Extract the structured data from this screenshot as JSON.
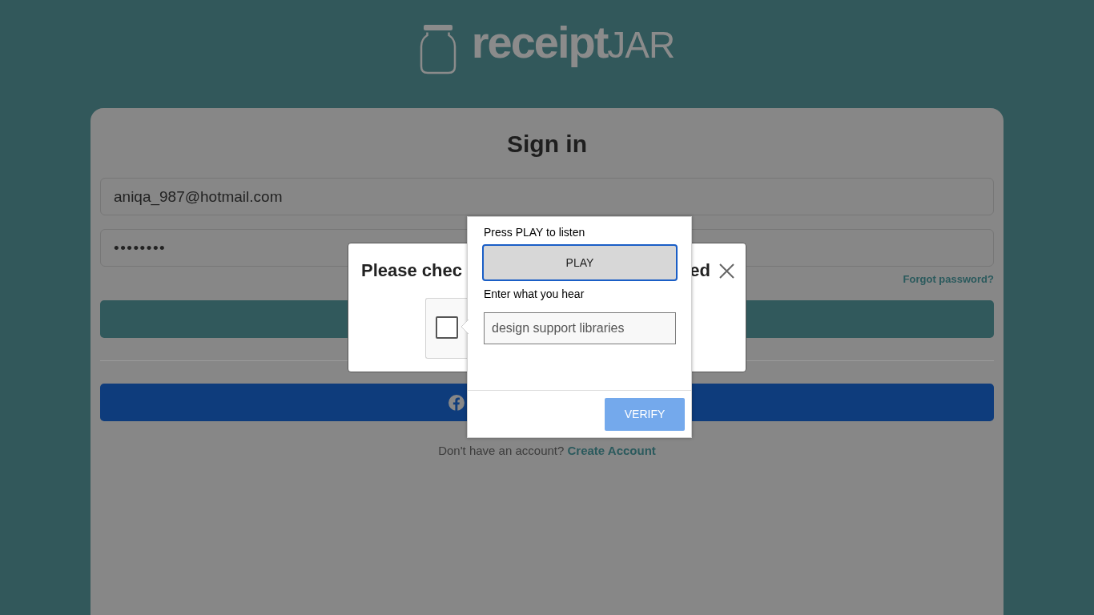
{
  "logo": {
    "text": "**receipt**JAR"
  },
  "sign_in": {
    "title": "Sign in",
    "email_field": {
      "value": "aniqa_987@hotmail.com"
    },
    "password_field": {
      "value": "••••••••"
    },
    "forgot_password_link": "Forgot password?",
    "signup_prompt": {
      "text": "Don't have an account?",
      "link": "Create Account"
    }
  },
  "dialog": {
    "title_start": "Please chec",
    "title_end": "ed",
    "recaptcha": {
      "checked": false
    }
  },
  "captcha_popup": {
    "instruction": "Press PLAY to listen",
    "play_button": {
      "label": "PLAY",
      "focused": true
    },
    "answer_label": "Enter what you hear",
    "answer_field": {
      "value": "design support libraries"
    },
    "verify_button": {
      "label": "VERIFY"
    }
  }
}
